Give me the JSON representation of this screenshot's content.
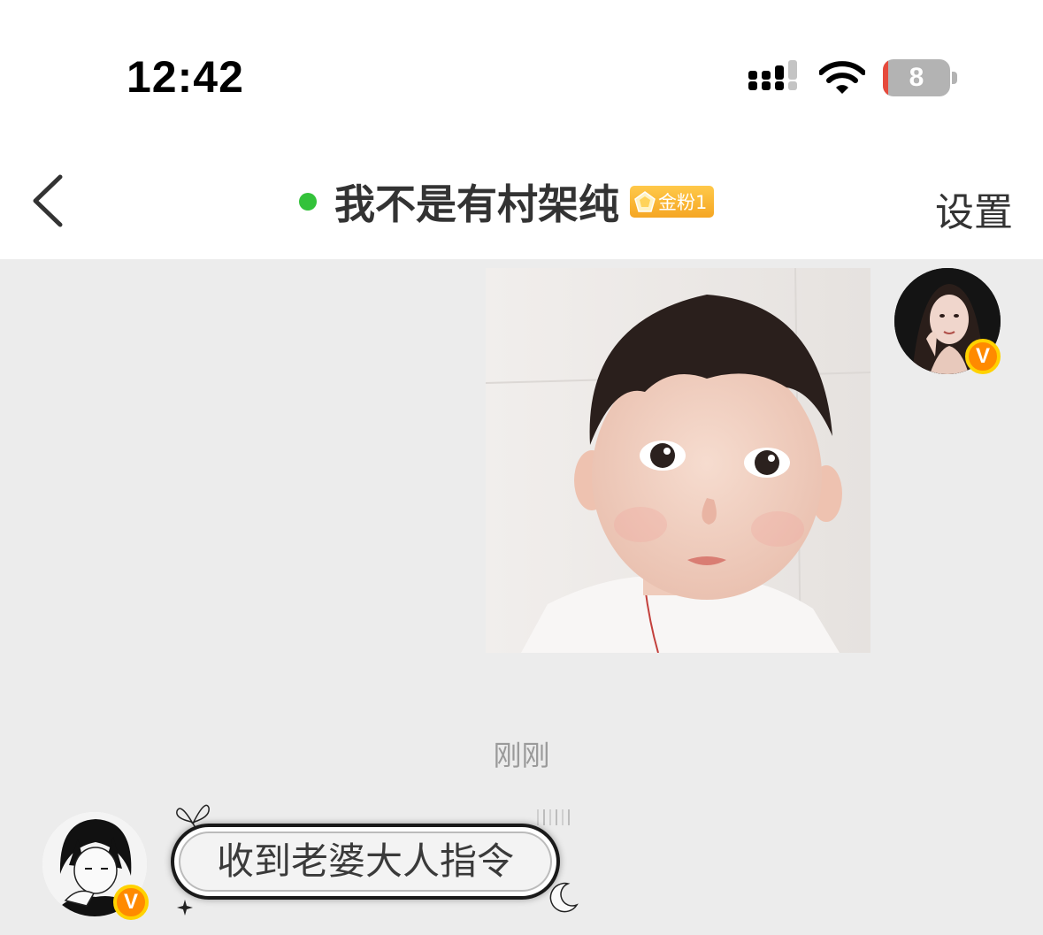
{
  "status_bar": {
    "time": "12:42",
    "battery_level": "8",
    "battery_fraction": 0.08,
    "icons": [
      "signal-icon",
      "wifi-icon",
      "battery-icon"
    ]
  },
  "nav": {
    "back_icon": "chevron-left-icon",
    "title": "我不是有村架纯",
    "online": true,
    "online_color": "#33c23a",
    "badge_label": "金粉1",
    "settings_label": "设置"
  },
  "messages": {
    "photo": {
      "sender": "me",
      "subject": "toddler-photo"
    },
    "timestamp": "刚刚",
    "reply_text": "收到老婆大人指令"
  },
  "colors": {
    "chat_background": "#ececec",
    "verified_badge": "#ff8a00",
    "fan_badge": "#f5a623"
  }
}
